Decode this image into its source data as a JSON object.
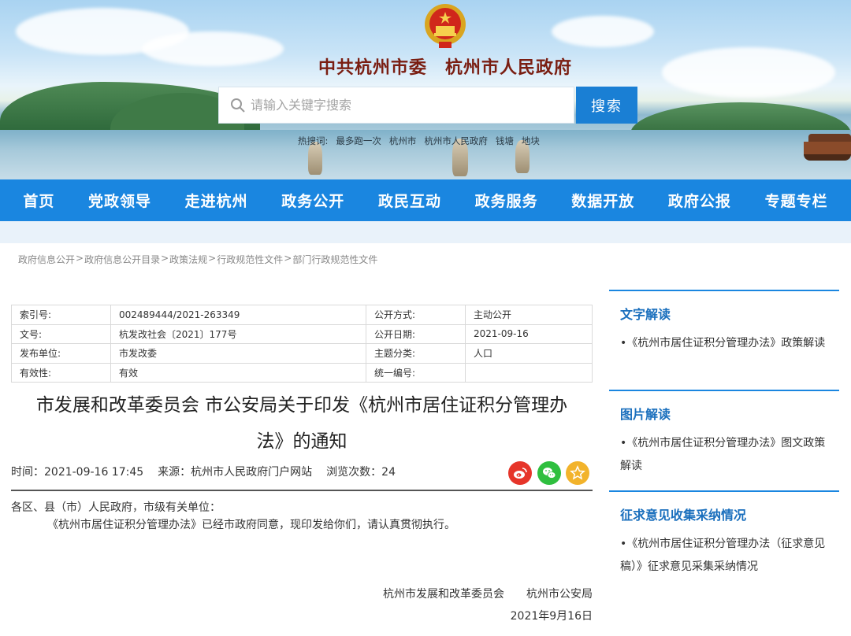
{
  "header": {
    "site_title": "中共杭州市委　杭州市人民政府",
    "search_placeholder": "请输入关键字搜索",
    "search_button": "搜索",
    "hot_words": [
      "热搜词:",
      "最多跑一次",
      "杭州市",
      "杭州市人民政府",
      "钱塘",
      "地块"
    ]
  },
  "nav": {
    "items": [
      "首页",
      "党政领导",
      "走进杭州",
      "政务公开",
      "政民互动",
      "政务服务",
      "数据开放",
      "政府公报",
      "专题专栏"
    ]
  },
  "breadcrumb": [
    "政府信息公开",
    "政府信息公开目录",
    "政策法规",
    "行政规范性文件",
    "部门行政规范性文件"
  ],
  "meta_table": {
    "rows": [
      [
        "索引号:",
        "002489444/2021-263349",
        "公开方式:",
        "主动公开"
      ],
      [
        "文号:",
        "杭发改社会〔2021〕177号",
        "公开日期:",
        "2021-09-16"
      ],
      [
        "发布单位:",
        "市发改委",
        "主题分类:",
        "人口"
      ],
      [
        "有效性:",
        "有效",
        "统一编号:",
        ""
      ]
    ]
  },
  "article": {
    "title_line1": "市发展和改革委员会 市公安局关于印发《杭州市居住证积分管理办",
    "title_line2": "法》的通知",
    "time": "时间：2021-09-16 17:45",
    "source": "来源：杭州市人民政府门户网站",
    "views": "浏览次数：24",
    "salutation": "各区、县（市）人民政府，市级有关单位：",
    "paragraph": "《杭州市居住证积分管理办法》已经市政府同意，现印发给你们，请认真贯彻执行。",
    "signature_orgs": "杭州市发展和改革委员会　　杭州市公安局",
    "signature_date": "2021年9月16日"
  },
  "sidebar": {
    "sections": [
      {
        "title": "文字解读",
        "item": "•《杭州市居住证积分管理办法》政策解读"
      },
      {
        "title": "图片解读",
        "item": "•《杭州市居住证积分管理办法》图文政策解读"
      },
      {
        "title": "征求意见收集采纳情况",
        "item": "•《杭州市居住证积分管理办法（征求意见稿）》征求意见采集采纳情况"
      }
    ]
  },
  "colors": {
    "nav_bg": "#1a86e0",
    "title_red": "#7a1e12",
    "sidebar_heading": "#1a6fbd",
    "weibo": "#e6352a",
    "wechat": "#2fbf3f",
    "favorite": "#f2b32b"
  },
  "icons": [
    "national-emblem-icon",
    "search-icon",
    "weibo-icon",
    "wechat-icon",
    "star-icon"
  ]
}
